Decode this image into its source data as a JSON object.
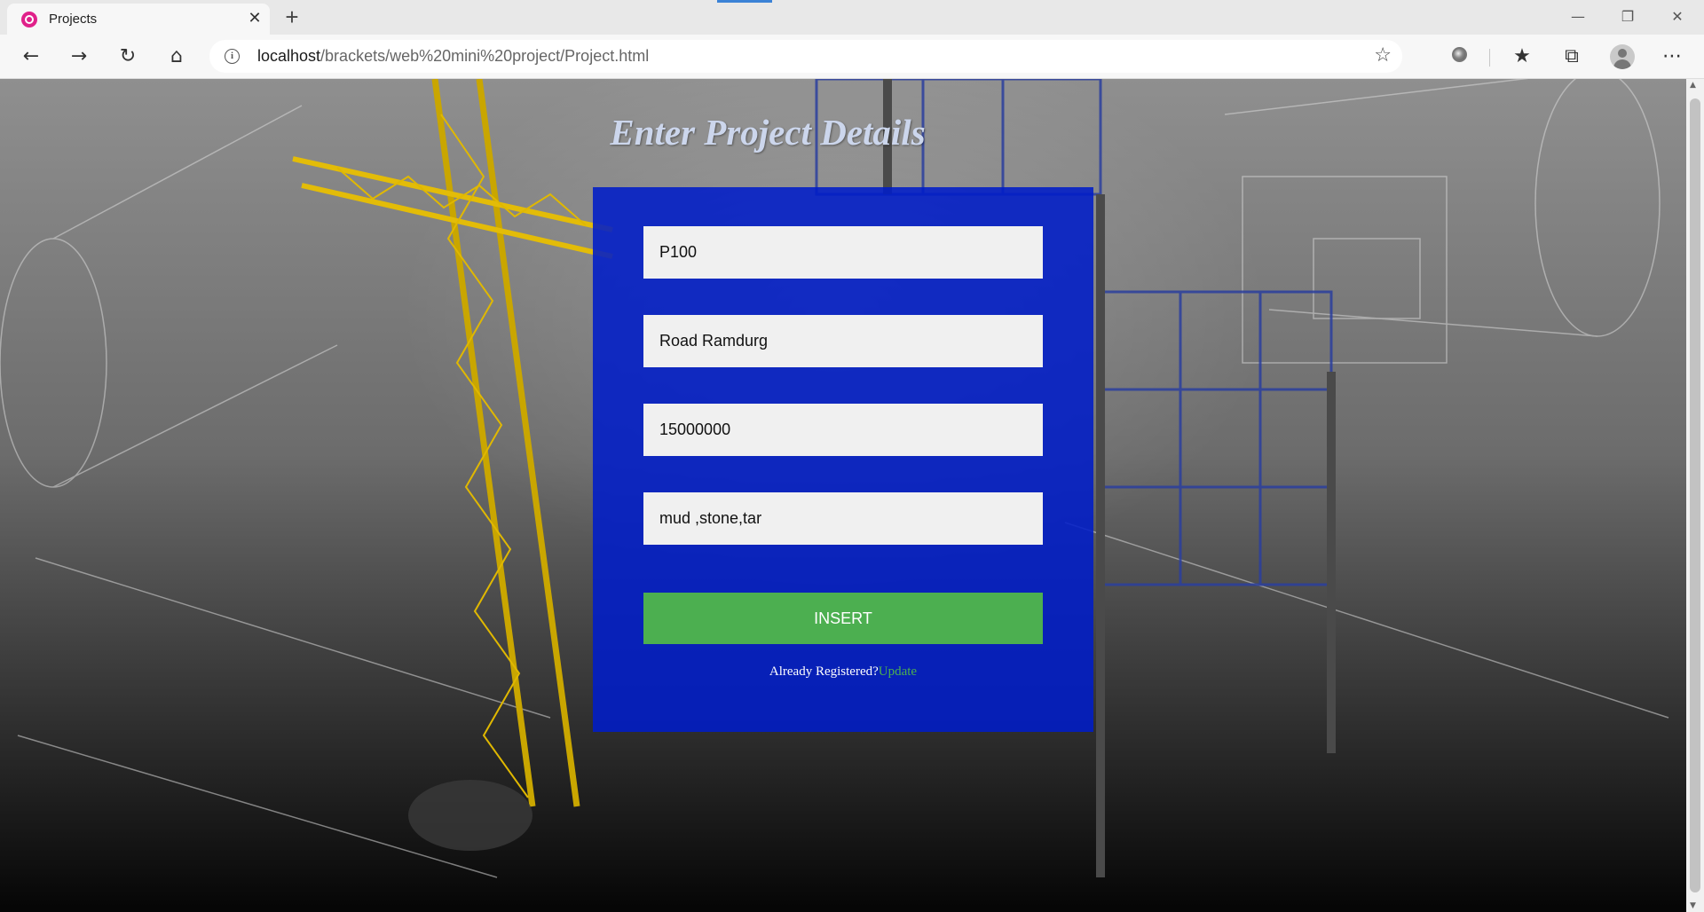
{
  "browser": {
    "tab_title": "Projects",
    "tab_close": "✕",
    "new_tab": "+",
    "url_host": "localhost",
    "url_path": "/brackets/web%20mini%20project/Project.html"
  },
  "page": {
    "heading": "Enter Project Details",
    "fields": [
      {
        "value": "P100"
      },
      {
        "value": "Road Ramdurg"
      },
      {
        "value": "15000000"
      },
      {
        "value": "mud ,stone,tar"
      }
    ],
    "insert_label": "INSERT",
    "register_text": "Already Registered?",
    "update_link": "Update"
  },
  "colors": {
    "panel": "#0a20c8",
    "button": "#4caf50",
    "link": "#4caf50"
  },
  "icons": [
    "back-icon",
    "forward-icon",
    "refresh-icon",
    "home-icon",
    "info-icon",
    "star-icon",
    "extension-icon",
    "favorites-icon",
    "collections-icon",
    "avatar",
    "more-icon"
  ]
}
